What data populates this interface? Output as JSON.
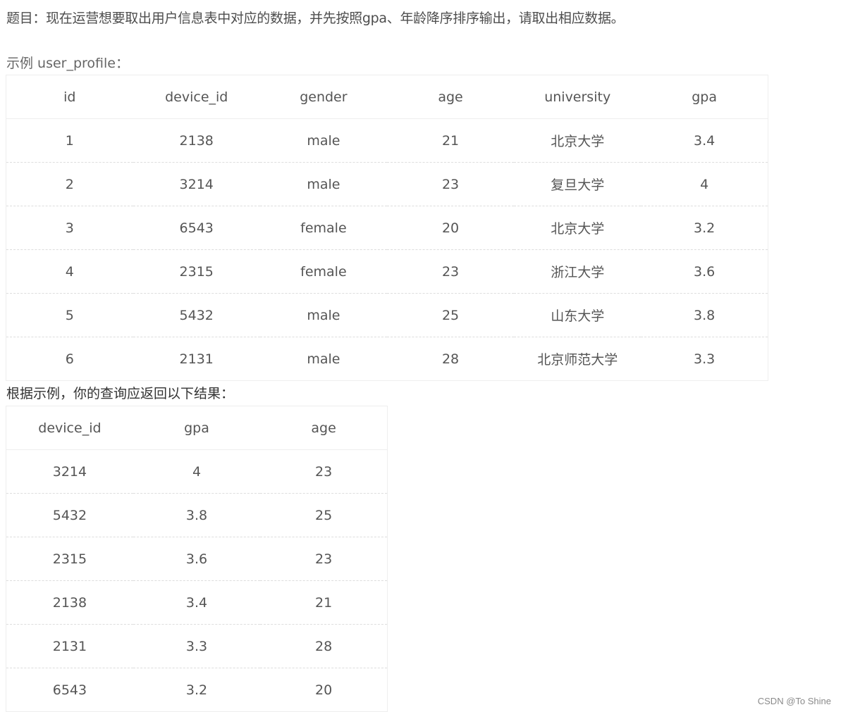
{
  "question": "题目：现在运营想要取出用户信息表中对应的数据，并先按照gpa、年龄降序排序输出，请取出相应数据。",
  "example_caption": "示例 user_profile：",
  "profile_table": {
    "headers": [
      "id",
      "device_id",
      "gender",
      "age",
      "university",
      "gpa"
    ],
    "rows": [
      [
        "1",
        "2138",
        "male",
        "21",
        "北京大学",
        "3.4"
      ],
      [
        "2",
        "3214",
        "male",
        "23",
        "复旦大学",
        "4"
      ],
      [
        "3",
        "6543",
        "female",
        "20",
        "北京大学",
        "3.2"
      ],
      [
        "4",
        "2315",
        "female",
        "23",
        "浙江大学",
        "3.6"
      ],
      [
        "5",
        "5432",
        "male",
        "25",
        "山东大学",
        "3.8"
      ],
      [
        "6",
        "2131",
        "male",
        "28",
        "北京师范大学",
        "3.3"
      ]
    ]
  },
  "result_caption": "根据示例，你的查询应返回以下结果：",
  "result_table": {
    "headers": [
      "device_id",
      "gpa",
      "age"
    ],
    "rows": [
      [
        "3214",
        "4",
        "23"
      ],
      [
        "5432",
        "3.8",
        "25"
      ],
      [
        "2315",
        "3.6",
        "23"
      ],
      [
        "2138",
        "3.4",
        "21"
      ],
      [
        "2131",
        "3.3",
        "28"
      ],
      [
        "6543",
        "3.2",
        "20"
      ]
    ]
  },
  "watermark": "CSDN @To Shine"
}
